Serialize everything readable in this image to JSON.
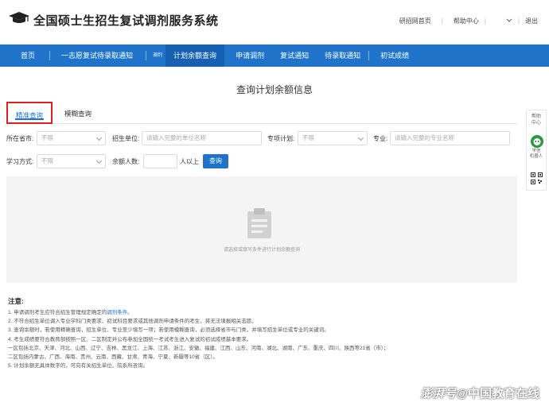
{
  "header": {
    "title": "全国硕士生招生复试调剂服务系统",
    "links": {
      "home": "研招网首页",
      "separator": "|",
      "help": "帮助中心",
      "logout": "退出"
    }
  },
  "nav": {
    "items": [
      {
        "label": "首页"
      },
      {
        "label": "一志愿复试待录取通知"
      },
      {
        "label": "调剂"
      },
      {
        "label": "计划余额查询"
      },
      {
        "label": "申请调剂"
      },
      {
        "label": "复试通知"
      },
      {
        "label": "待录取通知"
      },
      {
        "label": "初试成绩"
      }
    ]
  },
  "page": {
    "heading": "查询计划余额信息"
  },
  "tabs": {
    "exact": "精准查询",
    "fuzzy": "模糊查询"
  },
  "form": {
    "province_label": "所在省市:",
    "province_value": "不限",
    "unit_label": "招生单位:",
    "unit_placeholder": "请输入完整的单位名称",
    "special_label": "专项计划:",
    "special_value": "不限",
    "major_label": "专业:",
    "major_placeholder": "请输入完整的专业名称",
    "mode_label": "学习方式:",
    "mode_value": "不限",
    "count_label": "余额人数:",
    "count_value": "",
    "count_suffix": "人以上",
    "query_button": "查询"
  },
  "result": {
    "empty_text": "请选择或填写条件进行计划余额查询"
  },
  "side": {
    "help": [
      "帮助",
      "中心"
    ],
    "bot": [
      "学信",
      "机器人"
    ]
  },
  "notes": {
    "title": "注意:",
    "line1_pre": "1. 申请调剂考生应符合招生管理规定确定的",
    "line1_link": "调剂条件",
    "line1_post": "。",
    "line2": "2. 不符合招生单位调入专业学科门类要求、初试科目要求或其他调剂申请条件的考生，将无法填报相关志愿。",
    "line3": "3. 查询余额时，若使用精确查询，招生单位、专业至少填写一项；若使用模糊查询，必须选择省市与门类，并填写招生单位或专业的关键词。",
    "line4": "4. 考生成绩要符合教育部按照一区、二区制定并公布参加全国统一考试考生进入复试的初试成绩基本要求。",
    "line5": "一区包括北京、天津、河北、山西、辽宁、吉林、黑龙江、上海、江苏、浙江、安徽、福建、江西、山东、河南、湖北、湖南、广东、重庆、四川、陕西等21省（市）；",
    "line6": "二区包括内蒙古、广西、海南、贵州、云南、西藏、甘肃、青海、宁夏、新疆等10省（区）。",
    "line7": "5. 计划余额无具体数字的，可向有关招生单位、院系所咨询。"
  },
  "watermark": {
    "brand": "澎湃号",
    "text": "@中国教育在线"
  },
  "colors": {
    "nav": "#1f74c9",
    "nav_active": "#1560b2",
    "highlight_border": "#e02020",
    "result_bg": "#f4f4f4"
  }
}
